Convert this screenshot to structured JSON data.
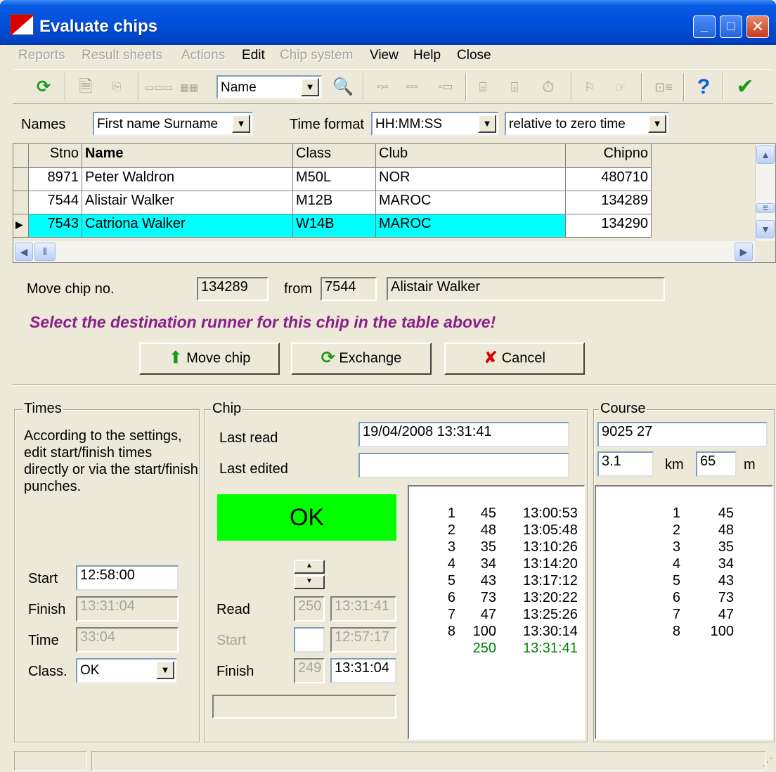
{
  "window": {
    "title": "Evaluate chips"
  },
  "menu": [
    {
      "label": "Reports",
      "enabled": false
    },
    {
      "label": "Result sheets",
      "enabled": false
    },
    {
      "label": "Actions",
      "enabled": false
    },
    {
      "label": "Edit",
      "enabled": true
    },
    {
      "label": "Chip system",
      "enabled": false
    },
    {
      "label": "View",
      "enabled": true
    },
    {
      "label": "Help",
      "enabled": true
    },
    {
      "label": "Close",
      "enabled": true
    }
  ],
  "toolbar": {
    "sort_value": "Name"
  },
  "filters": {
    "names_label": "Names",
    "names_value": "First name Surname",
    "time_format_label": "Time format",
    "time_format_value": "HH:MM:SS",
    "time_relative_value": "relative to zero time"
  },
  "grid": {
    "columns": [
      "Stno",
      "Name",
      "Class",
      "Club",
      "Chipno"
    ],
    "rows": [
      {
        "stno": "8971",
        "name": "Peter Waldron",
        "class": "M50L",
        "club": "NOR",
        "chipno": "480710",
        "selected": false
      },
      {
        "stno": "7544",
        "name": "Alistair Walker",
        "class": "M12B",
        "club": "MAROC",
        "chipno": "134289",
        "selected": false
      },
      {
        "stno": "7543",
        "name": "Catriona Walker",
        "class": "W14B",
        "club": "MAROC",
        "chipno": "134290",
        "selected": true
      }
    ]
  },
  "move": {
    "label": "Move chip no.",
    "chip_no": "134289",
    "from_label": "from",
    "from_stno": "7544",
    "from_name": "Alistair Walker",
    "instruction": "Select the destination runner for this chip in the table above!",
    "move_button": "Move chip",
    "exchange_button": "Exchange",
    "cancel_button": "Cancel"
  },
  "times": {
    "title": "Times",
    "description": "According to the settings, edit start/finish times directly or via the start/finish punches.",
    "start_label": "Start",
    "start_value": "12:58:00",
    "finish_label": "Finish",
    "finish_value": "13:31:04",
    "time_label": "Time",
    "time_value": "33:04",
    "class_label": "Class.",
    "class_value": "OK"
  },
  "chip": {
    "title": "Chip",
    "last_read_label": "Last read",
    "last_read_value": "19/04/2008 13:31:41",
    "last_edited_label": "Last edited",
    "last_edited_value": "",
    "status": "OK",
    "read_label": "Read",
    "read_code": "250",
    "read_time": "13:31:41",
    "start_label": "Start",
    "start_code": "",
    "start_time": "12:57:17",
    "finish_label": "Finish",
    "finish_code": "249",
    "finish_time": "13:31:04",
    "punches": [
      {
        "n": "1",
        "code": "45",
        "time": "13:00:53"
      },
      {
        "n": "2",
        "code": "48",
        "time": "13:05:48"
      },
      {
        "n": "3",
        "code": "35",
        "time": "13:10:26"
      },
      {
        "n": "4",
        "code": "34",
        "time": "13:14:20"
      },
      {
        "n": "5",
        "code": "43",
        "time": "13:17:12"
      },
      {
        "n": "6",
        "code": "73",
        "time": "13:20:22"
      },
      {
        "n": "7",
        "code": "47",
        "time": "13:25:26"
      },
      {
        "n": "8",
        "code": "100",
        "time": "13:30:14"
      }
    ],
    "extra_punch": {
      "code": "250",
      "time": "13:31:41"
    }
  },
  "course": {
    "title": "Course",
    "name_value": "9025 27",
    "km_value": "3.1",
    "km_unit": "km",
    "m_value": "65",
    "m_unit": "m",
    "controls": [
      {
        "n": "1",
        "code": "45"
      },
      {
        "n": "2",
        "code": "48"
      },
      {
        "n": "3",
        "code": "35"
      },
      {
        "n": "4",
        "code": "34"
      },
      {
        "n": "5",
        "code": "43"
      },
      {
        "n": "6",
        "code": "73"
      },
      {
        "n": "7",
        "code": "47"
      },
      {
        "n": "8",
        "code": "100"
      }
    ]
  },
  "colors": {
    "title_bar": "#0050DD",
    "selected_row": "#00FFFF",
    "status_ok": "#00FF00",
    "instruction": "#8B1E8B",
    "extra_punch": "#008000"
  }
}
